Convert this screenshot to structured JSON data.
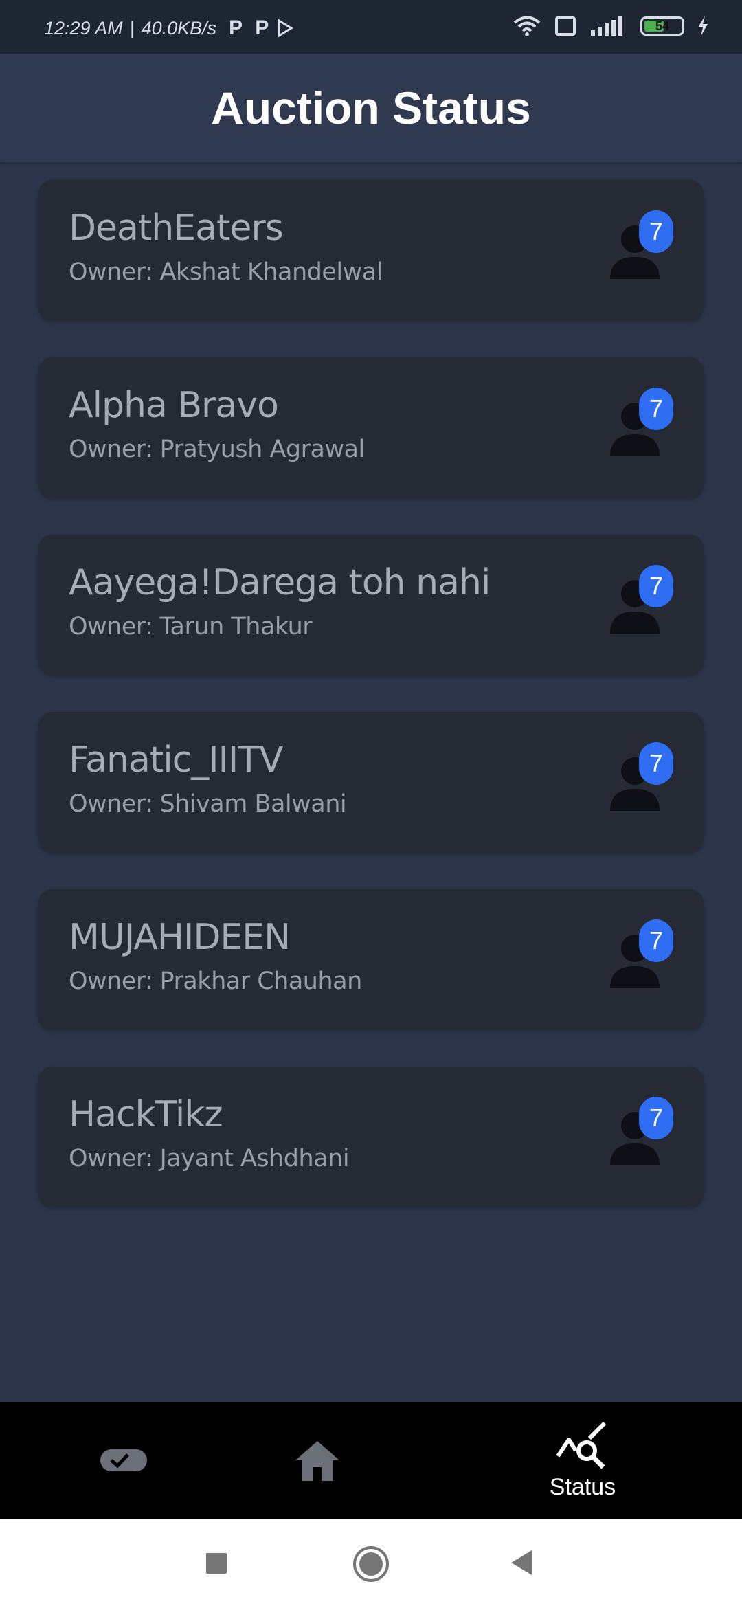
{
  "status_bar": {
    "time": "12:29 AM",
    "separator": "|",
    "network_speed": "40.0KB/s",
    "app_icon_1": "P",
    "app_icon_2": "P",
    "battery_level": "54"
  },
  "header": {
    "title": "Auction Status"
  },
  "owner_prefix": "Owner:",
  "teams": [
    {
      "name": "DeathEaters",
      "owner": "Akshat Khandelwal",
      "count": "7"
    },
    {
      "name": "Alpha Bravo",
      "owner": "Pratyush Agrawal",
      "count": "7"
    },
    {
      "name": "Aayega!Darega toh nahi",
      "owner": "Tarun Thakur",
      "count": "7"
    },
    {
      "name": "Fanatic_IIITV",
      "owner": "Shivam Balwani",
      "count": "7"
    },
    {
      "name": "MUJAHIDEEN",
      "owner": "Prakhar Chauhan",
      "count": "7"
    },
    {
      "name": "HackTikz",
      "owner": "Jayant Ashdhani",
      "count": "7"
    }
  ],
  "bottom_nav": {
    "items": [
      {
        "icon": "toggle-check-icon",
        "label": ""
      },
      {
        "icon": "home-icon",
        "label": ""
      },
      {
        "icon": "status-chart-search-icon",
        "label": "Status"
      }
    ]
  },
  "colors": {
    "background": "#2c3549",
    "header": "#2f3a50",
    "card": "#262a35",
    "badge": "#2f6df2",
    "nav": "#000000"
  }
}
